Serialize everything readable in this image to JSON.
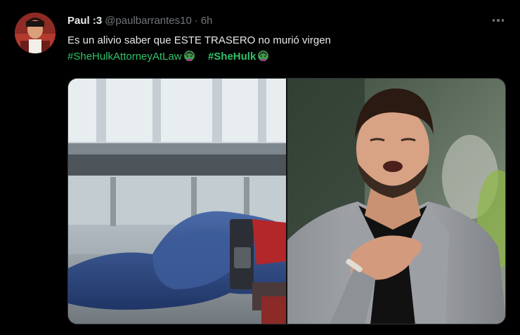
{
  "user": {
    "display_name": "Paul :3",
    "handle": "@paulbarrantes10",
    "separator": "·",
    "time": "6h"
  },
  "tweet": {
    "text": "Es un alivio saber que ESTE TRASERO no murió virgen",
    "hashtags": [
      "#SheHulkAttorneyAtLaw",
      "#SheHulk"
    ]
  },
  "colors": {
    "background": "#000000",
    "text": "#e7e9ea",
    "muted": "#71767b",
    "hashtag_green": "#2fc26b"
  },
  "icons": {
    "more": "more-horizontal-icon",
    "hashflag": "she-hulk-hashflag-icon"
  },
  "media": {
    "left_image": "costumed-figure-lying-face-down",
    "right_image": "man-relieved-hand-on-chest"
  }
}
